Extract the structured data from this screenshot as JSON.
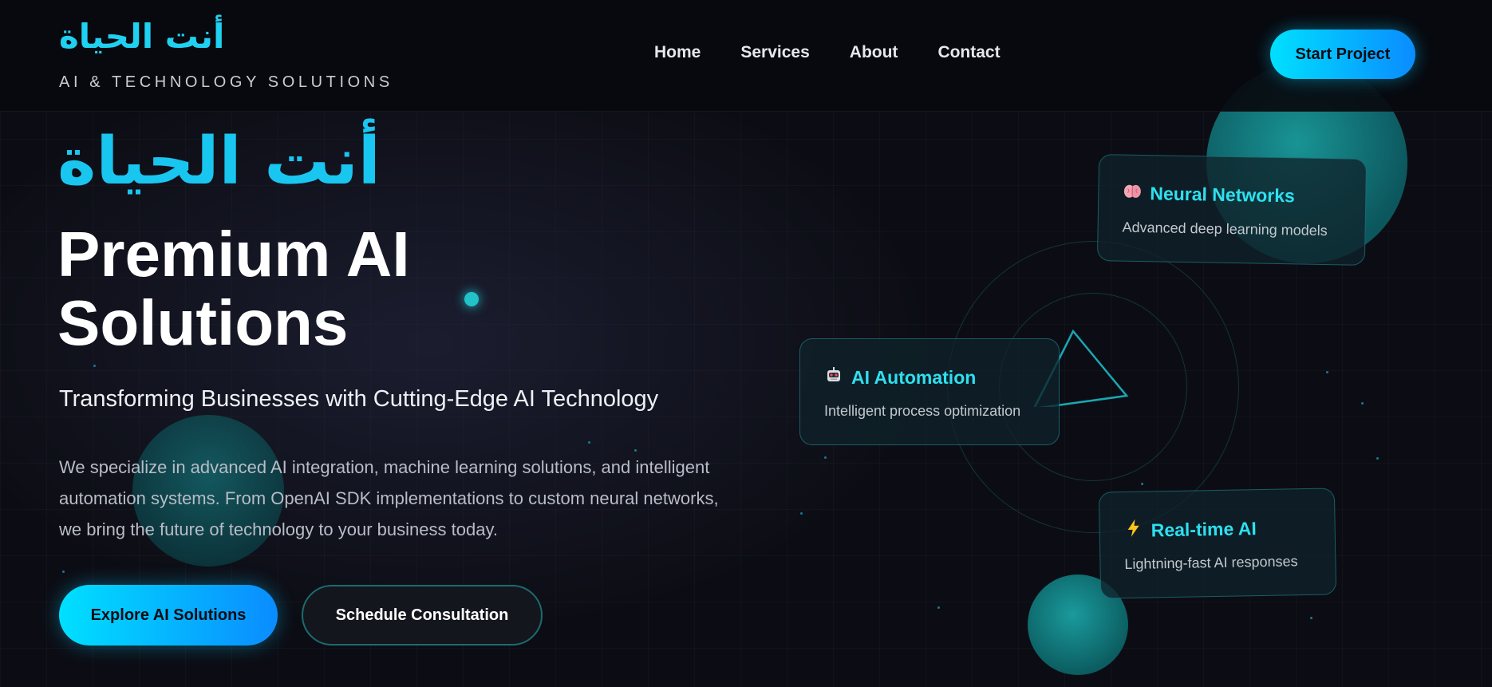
{
  "header": {
    "logo_arabic": "أنت الحياة",
    "logo_subtitle": "AI & TECHNOLOGY SOLUTIONS",
    "nav": [
      {
        "label": "Home"
      },
      {
        "label": "Services"
      },
      {
        "label": "About"
      },
      {
        "label": "Contact"
      }
    ],
    "cta_label": "Start Project"
  },
  "hero": {
    "arabic_title": "أنت الحياة",
    "title_line1": "Premium AI",
    "title_line2": "Solutions",
    "subtitle": "Transforming Businesses with Cutting-Edge AI Technology",
    "description": "We specialize in advanced AI integration, machine learning solutions, and intelligent automation systems. From OpenAI SDK implementations to custom neural networks, we bring the future of technology to your business today.",
    "primary_button": "Explore AI Solutions",
    "secondary_button": "Schedule Consultation"
  },
  "cards": {
    "neural": {
      "icon": "brain-icon",
      "title": "Neural Networks",
      "description": "Advanced deep learning models"
    },
    "automation": {
      "icon": "robot-icon",
      "title": "AI Automation",
      "description": "Intelligent process optimization"
    },
    "realtime": {
      "icon": "lightning-icon",
      "title": "Real-time AI",
      "description": "Lightning-fast AI responses"
    }
  },
  "colors": {
    "accent_cyan": "#00e0ff",
    "accent_blue": "#0a8cff",
    "background": "#0c0d14",
    "card_title": "#2ee0f0"
  }
}
